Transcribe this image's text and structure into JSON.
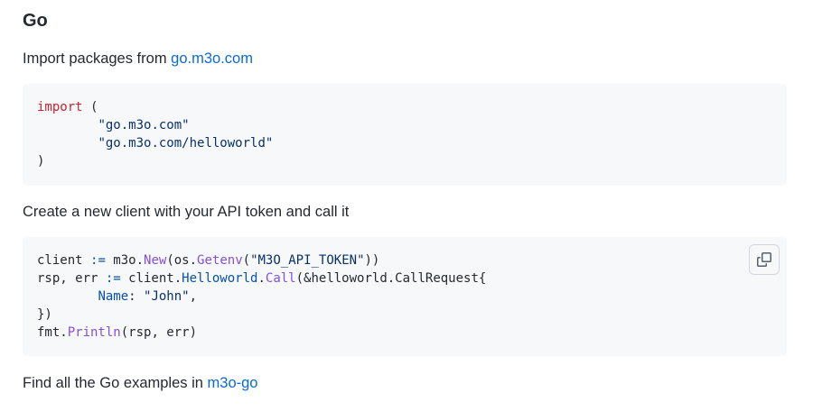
{
  "section": {
    "title": "Go"
  },
  "import_intro": {
    "text": "Import packages from ",
    "link": "go.m3o.com"
  },
  "import_code": {
    "import_kw": "import",
    "open_paren": " (",
    "pkg1": "\"go.m3o.com\"",
    "pkg2": "\"go.m3o.com/helloworld\"",
    "close_paren": ")"
  },
  "client_intro": {
    "text": "Create a new client with your API token and call it"
  },
  "client_code": {
    "l1": {
      "a": "client ",
      "op": ":=",
      "b": " m3o.",
      "fn1": "New",
      "c": "(os.",
      "fn2": "Getenv",
      "d": "(",
      "str": "\"M3O_API_TOKEN\"",
      "e": "))"
    },
    "l2": {
      "a": "rsp, err ",
      "op": ":=",
      "b": " client.",
      "prop": "Helloworld",
      "c": ".",
      "fn": "Call",
      "d": "(&helloworld.CallRequest{"
    },
    "l3": {
      "prop": "Name",
      "a": ": ",
      "str": "\"John\"",
      "b": ","
    },
    "l4": "})",
    "l5": {
      "a": "fmt.",
      "fn": "Println",
      "b": "(rsp, err)"
    }
  },
  "footer": {
    "text": "Find all the Go examples in ",
    "link": "m3o-go"
  },
  "colors": {
    "keyword": "#cf222e",
    "function": "#8250df",
    "property": "#0550ae",
    "string": "#0a3069",
    "link": "#0969da",
    "code_bg": "#f6f8fa"
  },
  "icons": {
    "copy": "copy-icon"
  }
}
